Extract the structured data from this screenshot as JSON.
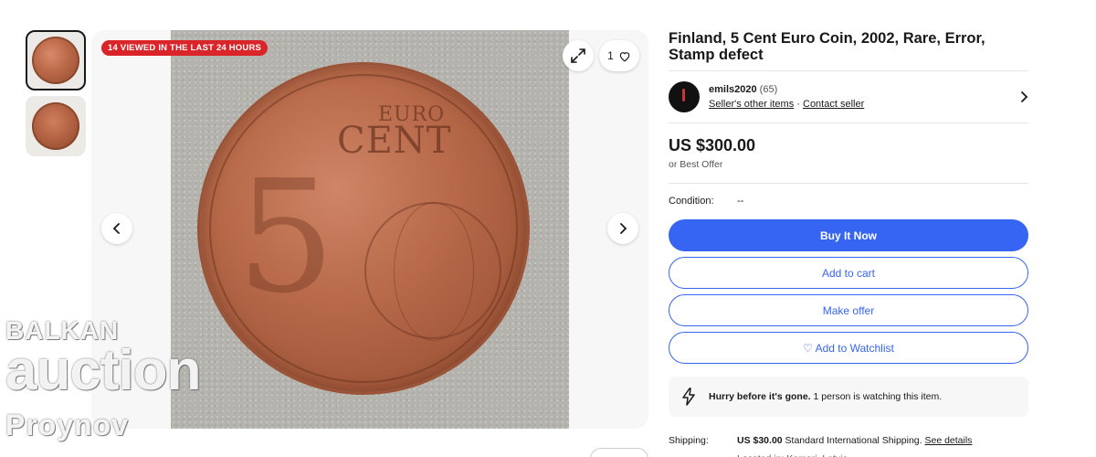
{
  "gallery": {
    "viewed_badge": "14 VIEWED IN THE LAST 24 HOURS",
    "watch_count": "1",
    "coin_text_top": "EURO",
    "coin_text_main": "CENT",
    "coin_numeral": "5"
  },
  "watermark": {
    "line1": "BALKAN",
    "line2": "auction",
    "line3": "Proynov"
  },
  "item": {
    "title": "Finland, 5 Cent Euro Coin, 2002, Rare, Error, Stamp defect",
    "price": "US $300.00",
    "best_offer": "or Best Offer",
    "condition_label": "Condition:",
    "condition_value": "--"
  },
  "seller": {
    "name": "emils2020",
    "feedback": "(65)",
    "other_items": "Seller's other items",
    "separator": "·",
    "contact": "Contact seller"
  },
  "actions": {
    "buy_now": "Buy It Now",
    "add_to_cart": "Add to cart",
    "make_offer": "Make offer",
    "watchlist": "♡ Add to Watchlist"
  },
  "hurry": {
    "bold": "Hurry before it's gone.",
    "text": " 1 person is watching this item."
  },
  "shipping": {
    "label": "Shipping:",
    "price": "US $30.00",
    "method": " Standard International Shipping. ",
    "details_link": "See details",
    "location": "Located in: Kemeri, Latvia"
  },
  "colors": {
    "primary": "#3665f3",
    "badge": "#d9252a"
  }
}
